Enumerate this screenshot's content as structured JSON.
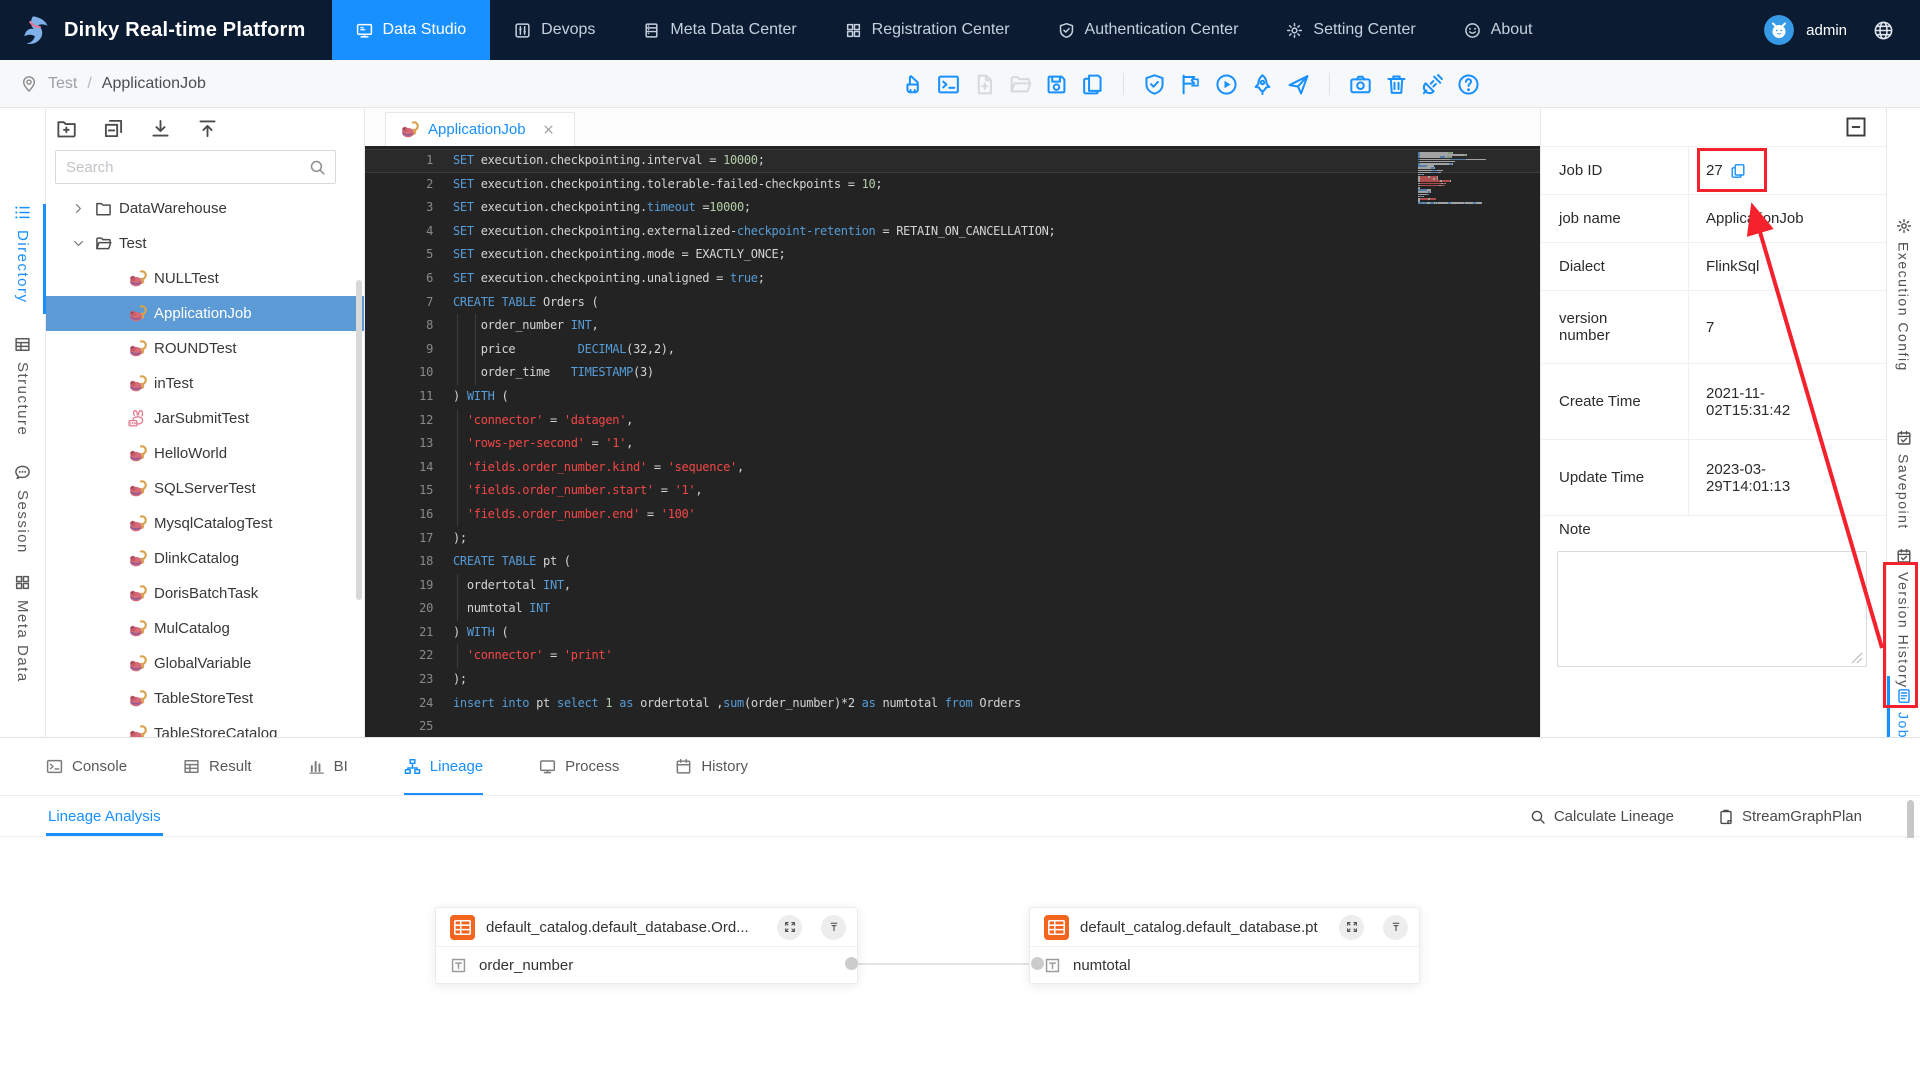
{
  "nav": {
    "brand": "Dinky Real-time Platform",
    "user": "admin",
    "items": [
      {
        "label": "Data Studio",
        "icon": "studio",
        "active": true
      },
      {
        "label": "Devops",
        "icon": "devops"
      },
      {
        "label": "Meta Data Center",
        "icon": "metadb"
      },
      {
        "label": "Registration Center",
        "icon": "grid"
      },
      {
        "label": "Authentication Center",
        "icon": "shield"
      },
      {
        "label": "Setting Center",
        "icon": "gear"
      },
      {
        "label": "About",
        "icon": "smile"
      }
    ]
  },
  "breadcrumb": {
    "parts": [
      "Test",
      "ApplicationJob"
    ],
    "separator": "/"
  },
  "toolbar": {
    "groups": [
      [
        {
          "name": "clean",
          "icon": "brush"
        },
        {
          "name": "console",
          "icon": "console"
        },
        {
          "name": "new-file",
          "icon": "fileadd",
          "disabled": true
        },
        {
          "name": "open-folder",
          "icon": "folderopen",
          "disabled": true
        },
        {
          "name": "save",
          "icon": "save"
        },
        {
          "name": "export",
          "icon": "copydoc"
        }
      ],
      [
        {
          "name": "validate",
          "icon": "shield"
        },
        {
          "name": "flag",
          "icon": "flag"
        },
        {
          "name": "run",
          "icon": "play"
        },
        {
          "name": "launch",
          "icon": "rocket"
        },
        {
          "name": "submit",
          "icon": "send"
        }
      ],
      [
        {
          "name": "snapshot",
          "icon": "camera"
        },
        {
          "name": "delete",
          "icon": "trash"
        },
        {
          "name": "api",
          "icon": "plug"
        },
        {
          "name": "help",
          "icon": "question"
        }
      ]
    ]
  },
  "left_rail": [
    {
      "label": "Directory",
      "icon": "list",
      "active": true
    },
    {
      "label": "Structure",
      "icon": "table2"
    },
    {
      "label": "Session",
      "icon": "chat"
    },
    {
      "label": "Meta Data",
      "icon": "grid"
    }
  ],
  "tree": {
    "search_placeholder": "Search",
    "toolbar": [
      {
        "name": "new-folder",
        "icon": "newfolder"
      },
      {
        "name": "collapse-all",
        "icon": "collapse"
      },
      {
        "name": "download",
        "icon": "download"
      },
      {
        "name": "upload",
        "icon": "upload"
      }
    ],
    "rows": [
      {
        "t": "folder",
        "label": "DataWarehouse",
        "state": "collapsed"
      },
      {
        "t": "folder",
        "label": "Test",
        "state": "expanded"
      },
      {
        "t": "job",
        "label": "NULLTest"
      },
      {
        "t": "job",
        "label": "ApplicationJob",
        "selected": true
      },
      {
        "t": "job",
        "label": "ROUNDTest"
      },
      {
        "t": "job",
        "label": "inTest"
      },
      {
        "t": "jar",
        "label": "JarSubmitTest"
      },
      {
        "t": "job",
        "label": "HelloWorld"
      },
      {
        "t": "job",
        "label": "SQLServerTest"
      },
      {
        "t": "job",
        "label": "MysqlCatalogTest"
      },
      {
        "t": "job",
        "label": "DlinkCatalog"
      },
      {
        "t": "job",
        "label": "DorisBatchTask"
      },
      {
        "t": "job",
        "label": "MulCatalog"
      },
      {
        "t": "job",
        "label": "GlobalVariable"
      },
      {
        "t": "job",
        "label": "TableStoreTest"
      },
      {
        "t": "job",
        "label": "TableStoreCatalog"
      }
    ]
  },
  "editor": {
    "tab": "ApplicationJob",
    "lines": [
      {
        "n": 1,
        "cur": true,
        "tk": [
          [
            "k",
            "SET"
          ],
          [
            "d",
            " execution.checkpointing.interval = "
          ],
          [
            "n",
            "10000"
          ],
          [
            "d",
            ";"
          ]
        ]
      },
      {
        "n": 2,
        "tk": [
          [
            "k",
            "SET"
          ],
          [
            "d",
            " execution.checkpointing.tolerable-failed-checkpoints = "
          ],
          [
            "n",
            "10"
          ],
          [
            "d",
            ";"
          ]
        ]
      },
      {
        "n": 3,
        "tk": [
          [
            "k",
            "SET"
          ],
          [
            "d",
            " execution.checkpointing."
          ],
          [
            "k",
            "timeout"
          ],
          [
            "d",
            " ="
          ],
          [
            "n",
            "10000"
          ],
          [
            "d",
            ";"
          ]
        ]
      },
      {
        "n": 4,
        "tk": [
          [
            "k",
            "SET"
          ],
          [
            "d",
            " execution.checkpointing.externalized-"
          ],
          [
            "k",
            "checkpoint-retention"
          ],
          [
            "d",
            " = RETAIN_ON_CANCELLATION;"
          ]
        ]
      },
      {
        "n": 5,
        "tk": [
          [
            "k",
            "SET"
          ],
          [
            "d",
            " execution.checkpointing.mode = EXACTLY_ONCE;"
          ]
        ]
      },
      {
        "n": 6,
        "tk": [
          [
            "k",
            "SET"
          ],
          [
            "d",
            " execution.checkpointing.unaligned = "
          ],
          [
            "k",
            "true"
          ],
          [
            "d",
            ";"
          ]
        ]
      },
      {
        "n": 7,
        "tk": [
          [
            "k",
            "CREATE TABLE"
          ],
          [
            "d",
            " Orders ("
          ]
        ]
      },
      {
        "n": 8,
        "ind": 2,
        "tk": [
          [
            "d",
            "    order_number "
          ],
          [
            "k",
            "INT"
          ],
          [
            "d",
            ","
          ]
        ]
      },
      {
        "n": 9,
        "ind": 2,
        "tk": [
          [
            "d",
            "    price         "
          ],
          [
            "k",
            "DECIMAL"
          ],
          [
            "d",
            "(32,2),"
          ]
        ]
      },
      {
        "n": 10,
        "ind": 2,
        "tk": [
          [
            "d",
            "    order_time   "
          ],
          [
            "k",
            "TIMESTAMP"
          ],
          [
            "d",
            "(3)"
          ]
        ]
      },
      {
        "n": 11,
        "tk": [
          [
            "d",
            ") "
          ],
          [
            "k",
            "WITH"
          ],
          [
            "d",
            " ("
          ]
        ]
      },
      {
        "n": 12,
        "ind": 1,
        "tk": [
          [
            "d",
            "  "
          ],
          [
            "s",
            "'connector'"
          ],
          [
            "d",
            " = "
          ],
          [
            "s",
            "'datagen'"
          ],
          [
            "d",
            ","
          ]
        ]
      },
      {
        "n": 13,
        "ind": 1,
        "tk": [
          [
            "d",
            "  "
          ],
          [
            "s",
            "'rows-per-second'"
          ],
          [
            "d",
            " = "
          ],
          [
            "s",
            "'1'"
          ],
          [
            "d",
            ","
          ]
        ]
      },
      {
        "n": 14,
        "ind": 1,
        "tk": [
          [
            "d",
            "  "
          ],
          [
            "s",
            "'fields.order_number.kind'"
          ],
          [
            "d",
            " = "
          ],
          [
            "s",
            "'sequence'"
          ],
          [
            "d",
            ","
          ]
        ]
      },
      {
        "n": 15,
        "ind": 1,
        "tk": [
          [
            "d",
            "  "
          ],
          [
            "s",
            "'fields.order_number.start'"
          ],
          [
            "d",
            " = "
          ],
          [
            "s",
            "'1'"
          ],
          [
            "d",
            ","
          ]
        ]
      },
      {
        "n": 16,
        "ind": 1,
        "tk": [
          [
            "d",
            "  "
          ],
          [
            "s",
            "'fields.order_number.end'"
          ],
          [
            "d",
            " = "
          ],
          [
            "s",
            "'100'"
          ]
        ]
      },
      {
        "n": 17,
        "tk": [
          [
            "d",
            ");"
          ]
        ]
      },
      {
        "n": 18,
        "tk": [
          [
            "k",
            "CREATE TABLE"
          ],
          [
            "d",
            " pt ("
          ]
        ]
      },
      {
        "n": 19,
        "ind": 1,
        "tk": [
          [
            "d",
            "  ordertotal "
          ],
          [
            "k",
            "INT"
          ],
          [
            "d",
            ","
          ]
        ]
      },
      {
        "n": 20,
        "ind": 1,
        "tk": [
          [
            "d",
            "  numtotal "
          ],
          [
            "k",
            "INT"
          ]
        ]
      },
      {
        "n": 21,
        "tk": [
          [
            "d",
            ") "
          ],
          [
            "k",
            "WITH"
          ],
          [
            "d",
            " ("
          ]
        ]
      },
      {
        "n": 22,
        "ind": 1,
        "tk": [
          [
            "d",
            "  "
          ],
          [
            "s",
            "'connector'"
          ],
          [
            "d",
            " = "
          ],
          [
            "s",
            "'print'"
          ]
        ]
      },
      {
        "n": 23,
        "tk": [
          [
            "d",
            ");"
          ]
        ]
      },
      {
        "n": 24,
        "tk": [
          [
            "k",
            "insert"
          ],
          [
            "d",
            " "
          ],
          [
            "k",
            "into"
          ],
          [
            "d",
            " pt "
          ],
          [
            "k",
            "select"
          ],
          [
            "d",
            " "
          ],
          [
            "n",
            "1"
          ],
          [
            "d",
            " "
          ],
          [
            "k",
            "as"
          ],
          [
            "d",
            " ordertotal ,"
          ],
          [
            "k",
            "sum"
          ],
          [
            "d",
            "(order_number)*2 "
          ],
          [
            "k",
            "as"
          ],
          [
            "d",
            " numtotal "
          ],
          [
            "k",
            "from"
          ],
          [
            "d",
            " Orders"
          ]
        ]
      },
      {
        "n": 25,
        "tk": []
      }
    ]
  },
  "job_info": {
    "rows": [
      {
        "label": "Job ID",
        "value": "27",
        "copy": true,
        "annotated": true
      },
      {
        "label": "job name",
        "value": "ApplicationJob"
      },
      {
        "label": "Dialect",
        "value": "FlinkSql"
      },
      {
        "label": "version number",
        "value": "7"
      },
      {
        "label": "Create Time",
        "value": "2021-11-02T15:31:42"
      },
      {
        "label": "Update Time",
        "value": "2023-03-29T14:01:13"
      }
    ],
    "note_label": "Note",
    "note_value": ""
  },
  "right_rail": {
    "items": [
      {
        "label": "Execution Config",
        "icon": "gear"
      },
      {
        "label": "Savepoint",
        "icon": "calcheck"
      },
      {
        "label": "Version History",
        "icon": "calcheck"
      },
      {
        "label": "Job Info",
        "icon": "docinfo",
        "active": true,
        "annotated": true
      }
    ],
    "more": "more-options"
  },
  "bottom": {
    "tabs": [
      {
        "label": "Console",
        "icon": "console"
      },
      {
        "label": "Result",
        "icon": "table2"
      },
      {
        "label": "BI",
        "icon": "bars"
      },
      {
        "label": "Lineage",
        "icon": "sitemap",
        "active": true
      },
      {
        "label": "Process",
        "icon": "monitor"
      },
      {
        "label": "History",
        "icon": "calendar"
      }
    ],
    "subtab": "Lineage Analysis",
    "actions": [
      {
        "label": "Calculate Lineage",
        "icon": "search"
      },
      {
        "label": "StreamGraphPlan",
        "icon": "clipboard"
      }
    ]
  },
  "lineage": {
    "nodes": [
      {
        "title": "default_catalog.default_database.Ord...",
        "fields": [
          "order_number"
        ],
        "dot": "right"
      },
      {
        "title": "default_catalog.default_database.pt",
        "fields": [
          "numtotal"
        ],
        "dot": "left"
      }
    ]
  },
  "colors": {
    "accent": "#1890ff",
    "annotation_red": "#f5222d",
    "tree_selected": "#5c9bd6",
    "editor_bg": "#232323",
    "code_keyword": "#569cd6",
    "code_string": "#f44747",
    "code_number": "#b5cea8"
  }
}
